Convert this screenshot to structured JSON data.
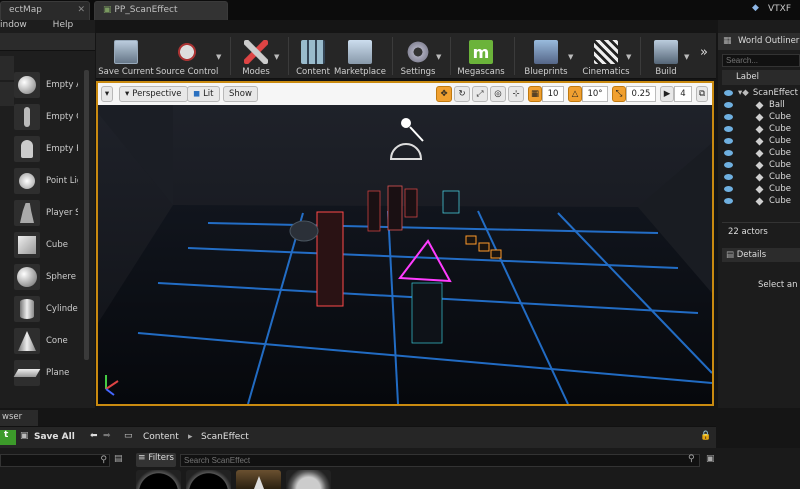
{
  "tabs": [
    {
      "label": "ectMap"
    },
    {
      "label": "PP_ScanEffect"
    }
  ],
  "window_right": {
    "label": "VTXF"
  },
  "menu": {
    "item": "indow",
    "help": "Help"
  },
  "place_items": [
    {
      "label": "Empty A",
      "icon": "empty-actor-icon"
    },
    {
      "label": "Empty C",
      "icon": "empty-character-icon"
    },
    {
      "label": "Empty P",
      "icon": "empty-pawn-icon"
    },
    {
      "label": "Point Lig",
      "icon": "point-light-icon"
    },
    {
      "label": "Player S",
      "icon": "player-start-icon"
    },
    {
      "label": "Cube",
      "icon": "cube-icon"
    },
    {
      "label": "Sphere",
      "icon": "sphere-icon"
    },
    {
      "label": "Cylinder",
      "icon": "cylinder-icon"
    },
    {
      "label": "Cone",
      "icon": "cone-icon"
    },
    {
      "label": "Plane",
      "icon": "plane-icon"
    }
  ],
  "toolbar": {
    "save_current": "Save Current",
    "source_control": "Source Control",
    "modes": "Modes",
    "content": "Content",
    "marketplace": "Marketplace",
    "settings": "Settings",
    "megascans": "Megascans",
    "blueprints": "Blueprints",
    "cinematics": "Cinematics",
    "build": "Build",
    "more": "»"
  },
  "viewport": {
    "perspective": "Perspective",
    "lit": "Lit",
    "show": "Show",
    "grid_snap": "10",
    "rotation_snap": "10°",
    "scale_snap": "0.25",
    "camera_speed": "4"
  },
  "outliner": {
    "title": "World Outliner",
    "search_placeholder": "Search...",
    "label_col": "Label",
    "rows": [
      "ScanEffect",
      "Ball",
      "Cube",
      "Cube",
      "Cube",
      "Cube",
      "Cube",
      "Cube",
      "Cube",
      "Cube"
    ],
    "actors": "22 actors"
  },
  "details": {
    "title": "Details",
    "hint": "Select an ob"
  },
  "content_browser": {
    "tab": "wser",
    "save_all": "Save All",
    "path_root": "Content",
    "path_leaf": "ScanEffect",
    "filters": "Filters",
    "search_placeholder": "Search ScanEffect"
  },
  "colors": {
    "accent": "#c98a10",
    "neon_blue": "#2a8cff",
    "neon_pink": "#ff3cff",
    "neon_red": "#ff4a4a",
    "neon_orange": "#ff9a2a"
  }
}
